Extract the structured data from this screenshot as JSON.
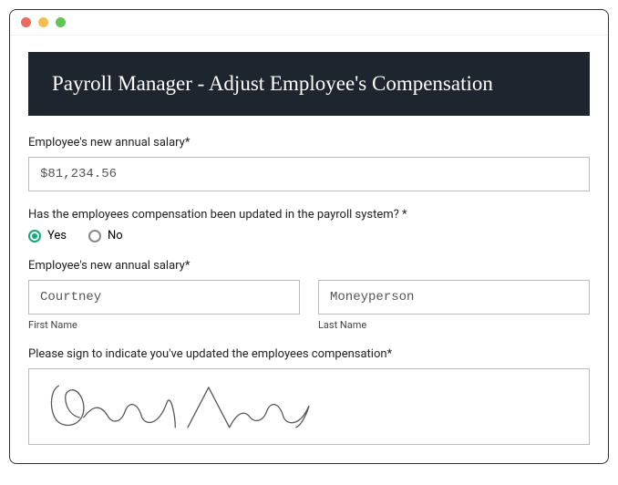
{
  "header": {
    "title": "Payroll Manager - Adjust Employee's Compensation"
  },
  "salary": {
    "label": "Employee's new annual salary*",
    "value": "$81,234.56"
  },
  "updated_question": {
    "label": "Has the employees compensation been updated in the payroll system? *",
    "yes_label": "Yes",
    "no_label": "No"
  },
  "name_section": {
    "label": "Employee's new annual salary*",
    "first_name": "Courtney",
    "last_name": "Moneyperson",
    "first_sublabel": "First Name",
    "last_sublabel": "Last Name"
  },
  "signature": {
    "label": "Please sign to indicate you've updated the employees compensation*"
  }
}
